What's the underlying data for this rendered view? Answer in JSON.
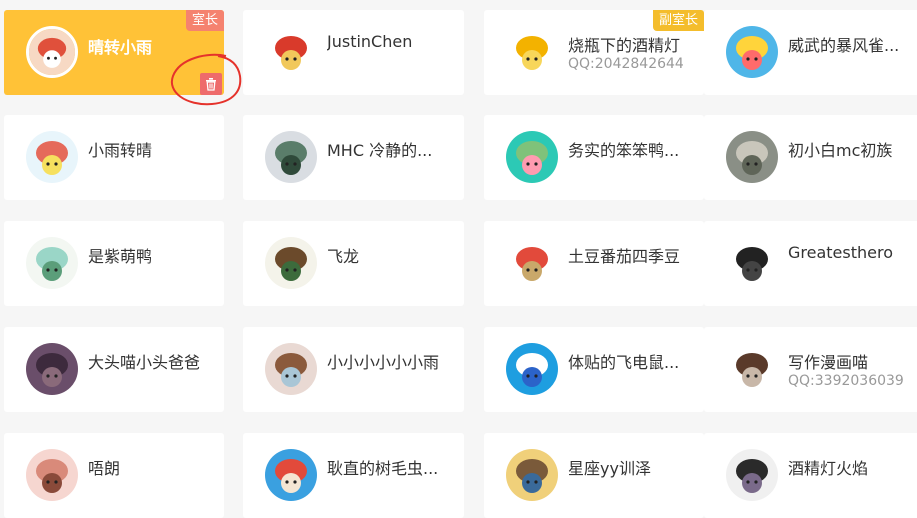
{
  "colors": {
    "active_card": "#ffc237",
    "owner_badge": "#f5826f",
    "vice_badge": "#f4bd2c",
    "delete_button": "#ee6b6b",
    "annotation": "#e5322b"
  },
  "members": [
    {
      "name": "晴转小雨",
      "role": "室长",
      "qq": "",
      "active": true,
      "avatar_icon": "red-mushroom-avatar"
    },
    {
      "name": "JustinChen",
      "role": "",
      "qq": "",
      "active": false,
      "avatar_icon": "red-dragon-avatar"
    },
    {
      "name": "烧瓶下的酒精灯",
      "role": "副室长",
      "qq": "QQ:2042842644",
      "active": false,
      "avatar_icon": "flame-avatar"
    },
    {
      "name": "威武的暴风雀...",
      "role": "",
      "qq": "",
      "active": false,
      "avatar_icon": "blue-bird-avatar"
    },
    {
      "name": "小雨转晴",
      "role": "",
      "qq": "",
      "active": false,
      "avatar_icon": "mushroom-avatar"
    },
    {
      "name": "MHC  冷静的...",
      "role": "",
      "qq": "",
      "active": false,
      "avatar_icon": "dragon-sketch-avatar"
    },
    {
      "name": "务实的笨笨鸭...",
      "role": "",
      "qq": "",
      "active": false,
      "avatar_icon": "green-bear-avatar"
    },
    {
      "name": "初小白mc初族",
      "role": "",
      "qq": "",
      "active": false,
      "avatar_icon": "blocky-figure-avatar"
    },
    {
      "name": "是紫萌鸭",
      "role": "",
      "qq": "",
      "active": false,
      "avatar_icon": "white-creature-avatar"
    },
    {
      "name": "飞龙",
      "role": "",
      "qq": "",
      "active": false,
      "avatar_icon": "anime-boy-avatar"
    },
    {
      "name": "土豆番茄四季豆",
      "role": "",
      "qq": "",
      "active": false,
      "avatar_icon": "vegetables-avatar"
    },
    {
      "name": "Greatesthero",
      "role": "",
      "qq": "",
      "active": false,
      "avatar_icon": "black-block-avatar"
    },
    {
      "name": "大头喵小头爸爸",
      "role": "",
      "qq": "",
      "active": false,
      "avatar_icon": "dark-photo-avatar"
    },
    {
      "name": "小小小小小小雨",
      "role": "",
      "qq": "",
      "active": false,
      "avatar_icon": "anime-girl-avatar"
    },
    {
      "name": "体贴的飞电鼠...",
      "role": "",
      "qq": "",
      "active": false,
      "avatar_icon": "blue-mouse-avatar"
    },
    {
      "name": "写作漫画喵",
      "role": "",
      "qq": "QQ:3392036039",
      "active": false,
      "avatar_icon": "pixel-cat-avatar"
    },
    {
      "name": "唔朗",
      "role": "",
      "qq": "",
      "active": false,
      "avatar_icon": "pink-hair-avatar"
    },
    {
      "name": "耿直的树毛虫...",
      "role": "",
      "qq": "",
      "active": false,
      "avatar_icon": "mushroom-cap-avatar"
    },
    {
      "name": "星座yy训泽",
      "role": "",
      "qq": "",
      "active": false,
      "avatar_icon": "landscape-avatar"
    },
    {
      "name": "酒精灯火焰",
      "role": "",
      "qq": "",
      "active": false,
      "avatar_icon": "dark-character-avatar"
    }
  ],
  "icons": {
    "delete": "trash-icon"
  }
}
